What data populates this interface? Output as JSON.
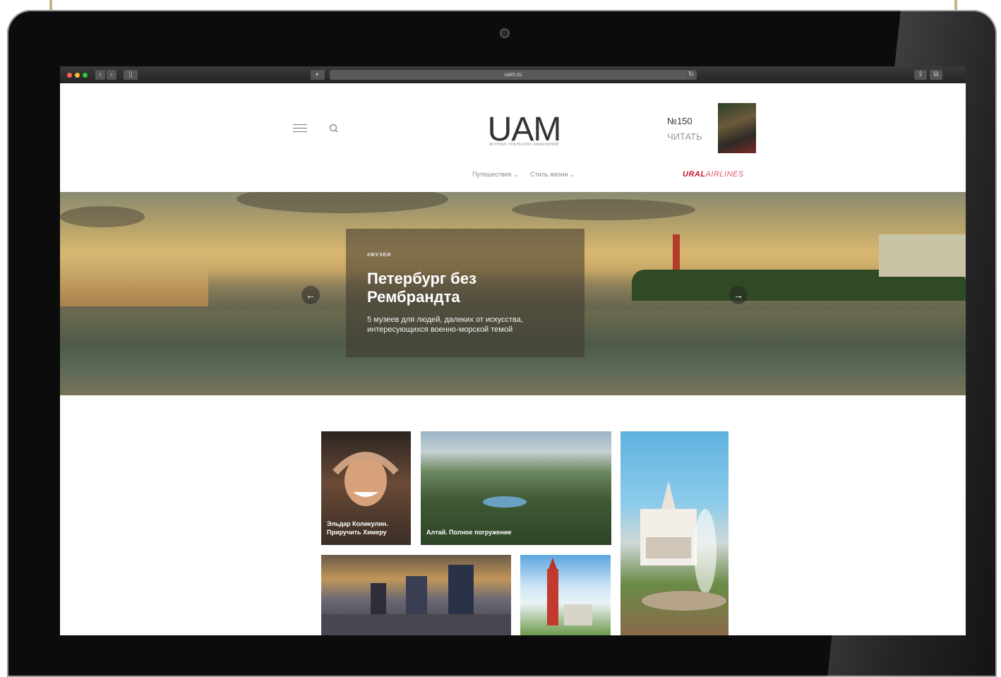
{
  "browser": {
    "url": "uam.ru"
  },
  "header": {
    "logo": "UAM",
    "logo_subtitle": "ЖУРНАЛ УРАЛЬСКИХ АВИАЛИНИЙ",
    "issue_number": "№150",
    "issue_read": "ЧИТАТЬ",
    "nav": [
      {
        "label": "Путешествия ⌄"
      },
      {
        "label": "Стиль жизни ⌄"
      }
    ],
    "airline_bold": "URAL",
    "airline_light": "AIRLINES"
  },
  "hero": {
    "tag": "#МУЗЕИ",
    "title": "Петербург без Рембрандта",
    "subtitle": "5 музеев для людей, далеких от искусства, интересующихся военно-морской темой",
    "prev_arrow": "←",
    "next_arrow": "→"
  },
  "tiles": [
    {
      "caption": "Эльдар Коликулин. Приручить Химеру"
    },
    {
      "caption": "Алтай. Полное погружение"
    },
    {
      "caption": ""
    },
    {
      "caption": ""
    },
    {
      "caption": ""
    }
  ],
  "colors": {
    "brand_red": "#c8102e",
    "bezel": "#0c0c0c",
    "frame_gold": "#c9b48a"
  },
  "icons": {
    "menu": "hamburger-icon",
    "search": "search-icon",
    "apple": "apple-logo-icon",
    "camera": "camera-icon"
  }
}
